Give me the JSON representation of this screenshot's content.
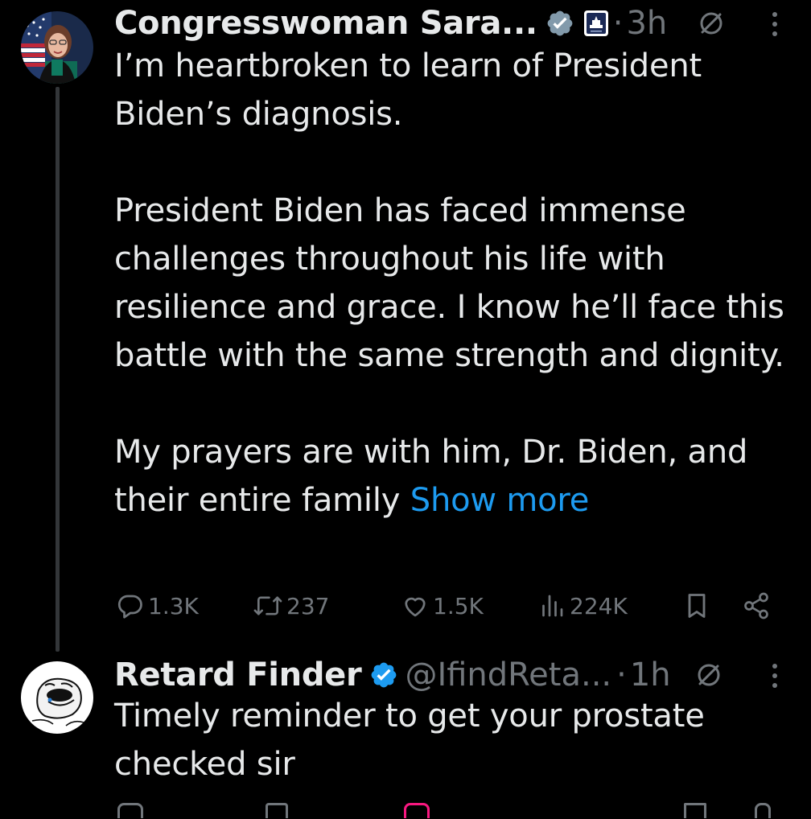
{
  "posts": [
    {
      "name": "Congresswoman Sara...",
      "time": "3h",
      "dot": "·",
      "paragraphs": [
        "I’m heartbroken to learn of President Biden’s diagnosis.",
        "President Biden has faced immense challenges throughout his life with resilience and grace. I know he’ll face this battle with the same strength and dignity.",
        "My prayers are with him, Dr. Biden, and their entire family"
      ],
      "show_more": "Show more",
      "stats": {
        "replies": "1.3K",
        "reposts": "237",
        "likes": "1.5K",
        "views": "224K"
      }
    },
    {
      "name": "Retard Finder",
      "handle": "@IfindReta...",
      "time": "1h",
      "dot": "·",
      "text": "Timely reminder to get your prostate checked sir"
    }
  ],
  "colors": {
    "background": "#000000",
    "text": "#e7e9ea",
    "muted": "#71767b",
    "link": "#1d9bf0",
    "verified": "#1d9bf0",
    "gov_badge": "#ffffff"
  },
  "icons": {
    "verified": "verified-badge-icon",
    "gov": "capitol-badge-icon",
    "hide": "no-sign-icon",
    "more": "more-vertical-icon",
    "reply": "reply-icon",
    "repost": "repost-icon",
    "like": "heart-icon",
    "views": "views-icon",
    "bookmark": "bookmark-icon",
    "share": "share-icon"
  }
}
